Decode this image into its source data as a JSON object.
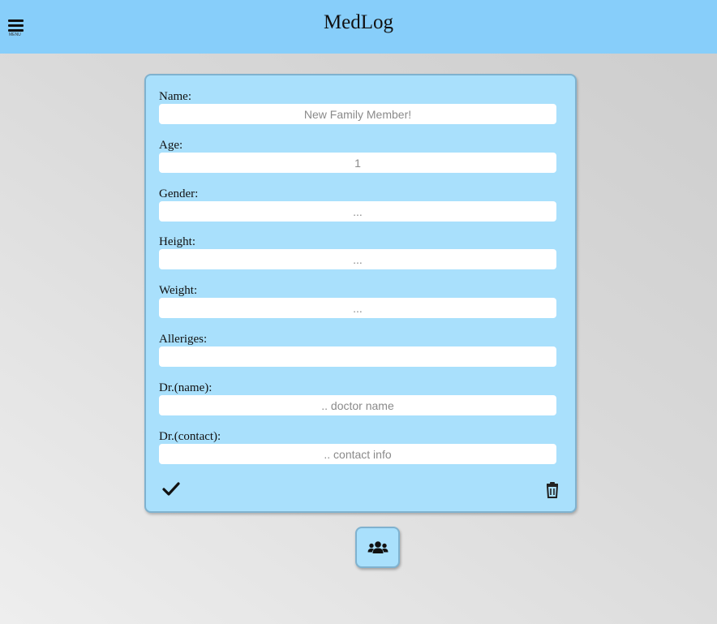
{
  "header": {
    "title": "MedLog",
    "menu_label": "MENU"
  },
  "form": {
    "fields": [
      {
        "label": "Name:",
        "value": "",
        "placeholder": "New Family Member!"
      },
      {
        "label": "Age:",
        "value": "",
        "placeholder": "1"
      },
      {
        "label": "Gender:",
        "value": "",
        "placeholder": "..."
      },
      {
        "label": "Height:",
        "value": "",
        "placeholder": "..."
      },
      {
        "label": "Weight:",
        "value": "",
        "placeholder": "..."
      },
      {
        "label": "Alleriges:",
        "value": "",
        "placeholder": ""
      },
      {
        "label": "Dr.(name):",
        "value": "",
        "placeholder": ".. doctor name"
      },
      {
        "label": "Dr.(contact):",
        "value": "",
        "placeholder": ".. contact info"
      }
    ]
  },
  "icons": {
    "menu": "hamburger-icon",
    "save": "check-icon",
    "delete": "trash-icon",
    "family": "users-icon"
  },
  "colors": {
    "header_bg": "#87cefa",
    "card_bg": "#a9e0fc",
    "card_border": "#7fb2cf"
  }
}
